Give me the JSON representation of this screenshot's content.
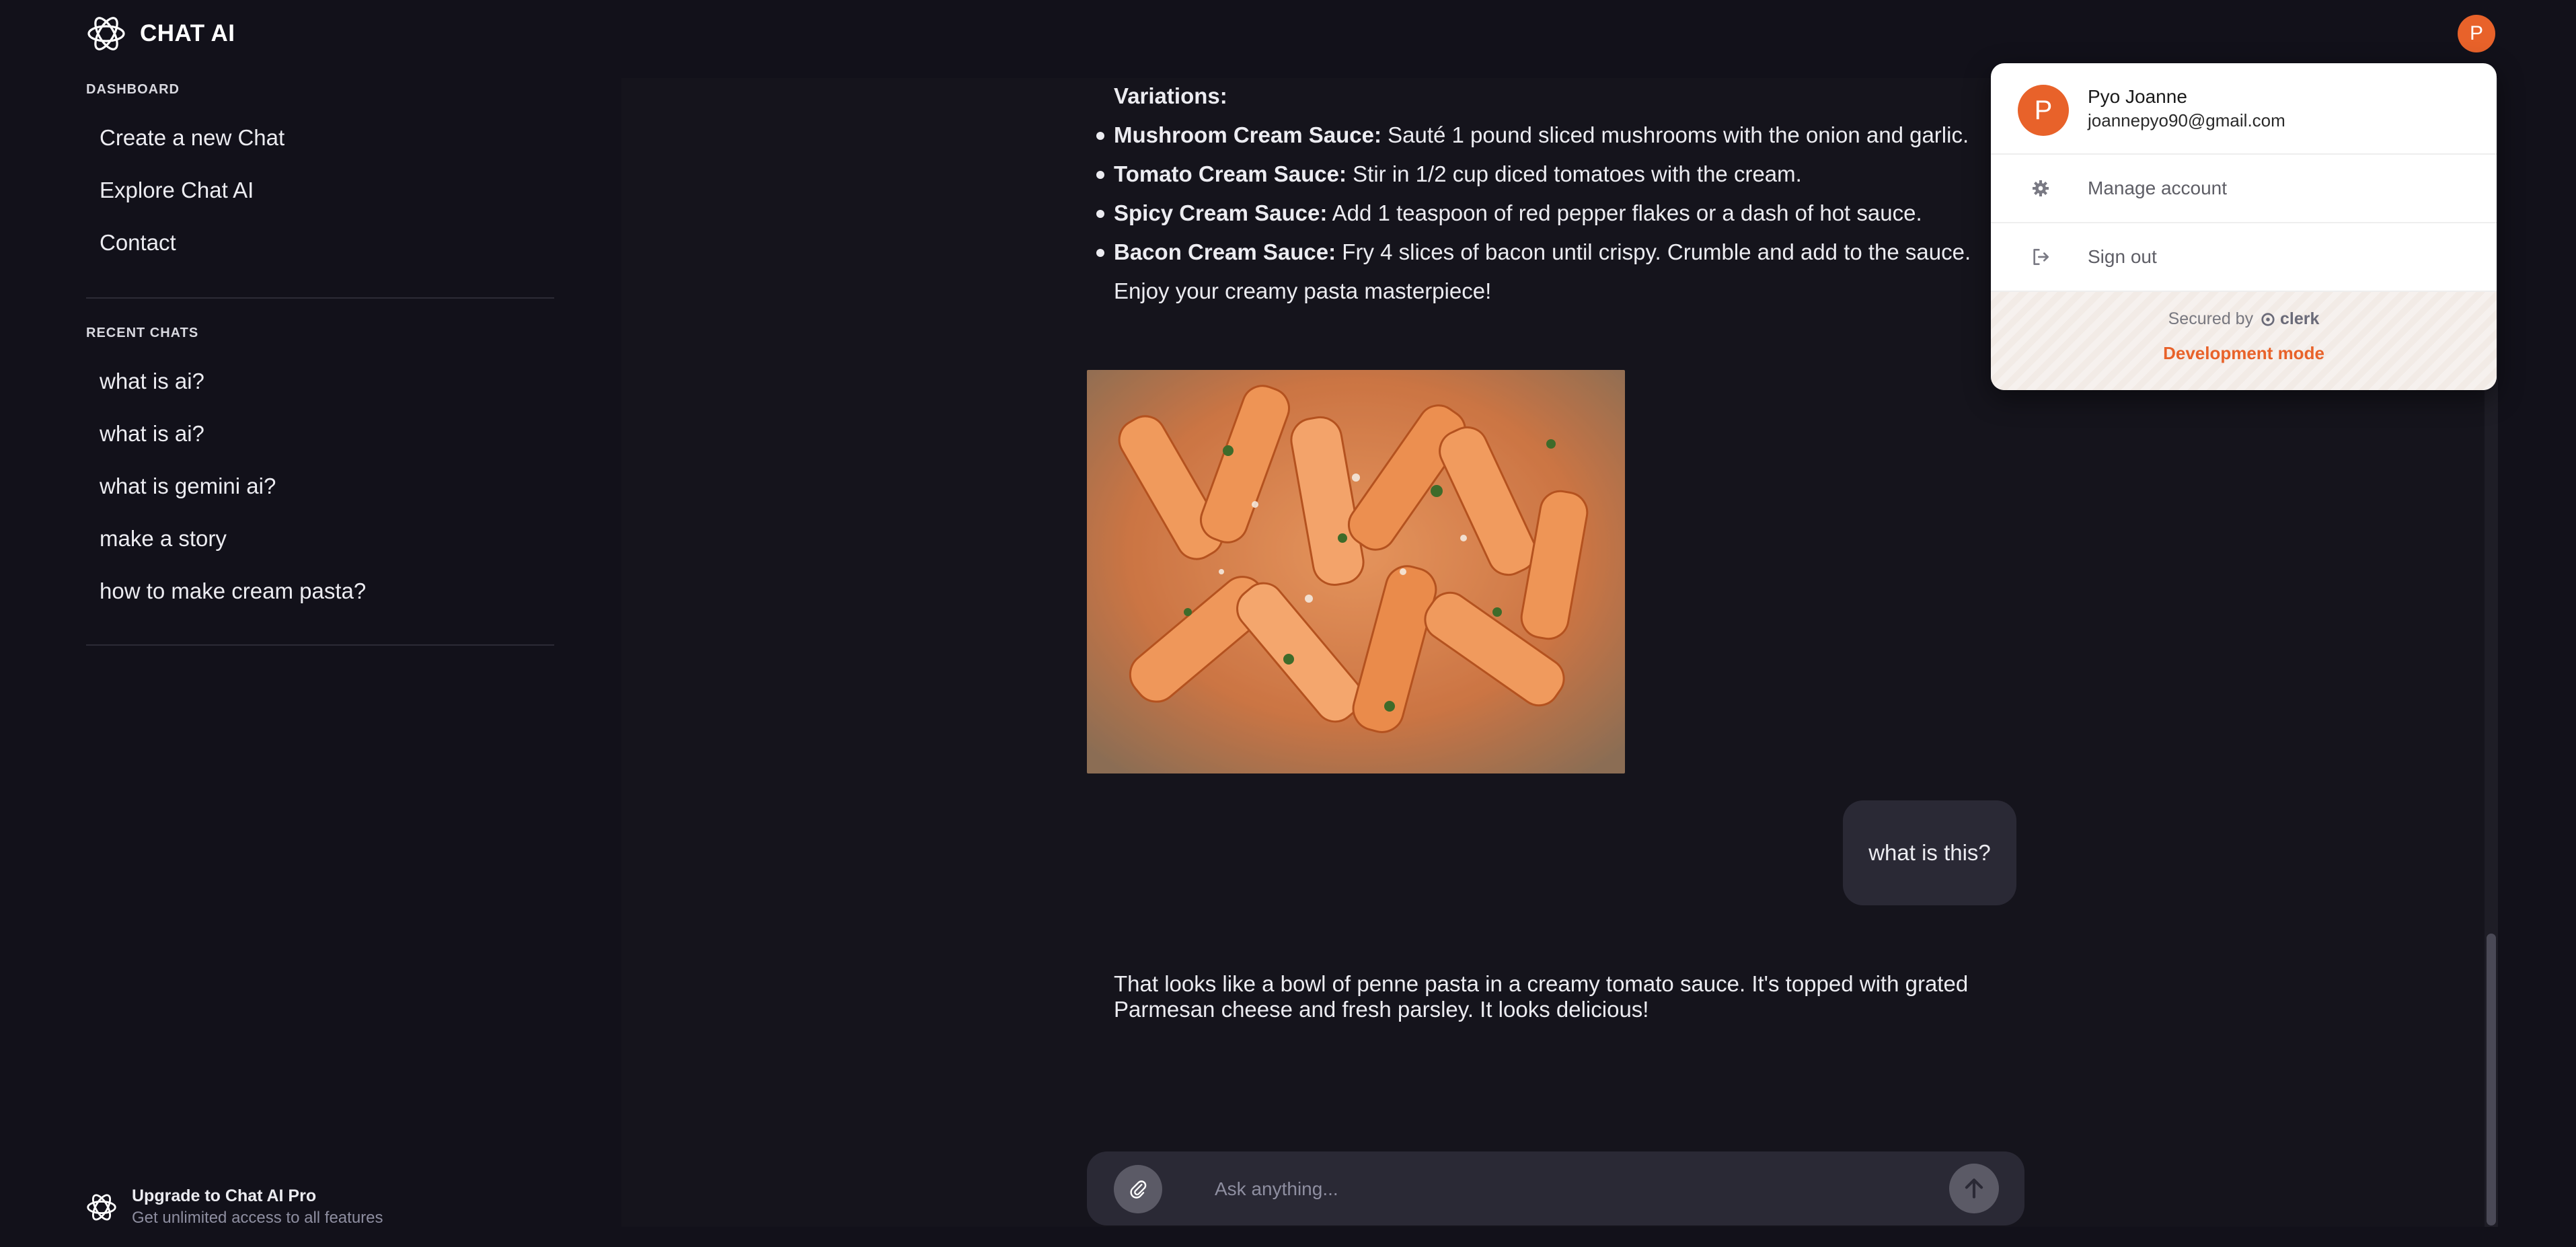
{
  "app": {
    "title": "CHAT AI",
    "user_initial": "P"
  },
  "sidebar": {
    "dashboard_label": "DASHBOARD",
    "items": [
      {
        "label": "Create a new Chat"
      },
      {
        "label": "Explore Chat AI"
      },
      {
        "label": "Contact"
      }
    ],
    "recent_label": "RECENT CHATS",
    "recent": [
      {
        "label": "what is ai?"
      },
      {
        "label": "what is ai?"
      },
      {
        "label": "what is gemini ai?"
      },
      {
        "label": "make a story"
      },
      {
        "label": "how to make cream pasta?"
      }
    ],
    "upgrade": {
      "title": "Upgrade to Chat AI Pro",
      "subtitle": "Get unlimited access to all features"
    }
  },
  "chat": {
    "variations_heading": "Variations:",
    "variations": [
      {
        "name": "Mushroom Cream Sauce:",
        "text": " Sauté 1 pound sliced mushrooms with the onion and garlic."
      },
      {
        "name": "Tomato Cream Sauce:",
        "text": " Stir in 1/2 cup diced tomatoes with the cream."
      },
      {
        "name": "Spicy Cream Sauce:",
        "text": " Add 1 teaspoon of red pepper flakes or a dash of hot sauce."
      },
      {
        "name": "Bacon Cream Sauce:",
        "text": " Fry 4 slices of bacon until crispy. Crumble and add to the sauce."
      }
    ],
    "closing": "Enjoy your creamy pasta masterpiece!",
    "user_message": "what is this?",
    "assistant_reply": "That looks like a bowl of penne pasta in a creamy tomato sauce. It's topped with grated Parmesan cheese and fresh parsley. It looks delicious!",
    "input_placeholder": "Ask anything..."
  },
  "account_menu": {
    "initial": "P",
    "name": "Pyo Joanne",
    "email": "joannepyo90@gmail.com",
    "manage": "Manage account",
    "signout": "Sign out",
    "secured_by": "Secured by",
    "secured_brand": "clerk",
    "dev_mode": "Development mode"
  },
  "colors": {
    "background": "#12111a",
    "panel": "#15141c",
    "bubble": "#2a2935",
    "accent": "#e8622a"
  }
}
